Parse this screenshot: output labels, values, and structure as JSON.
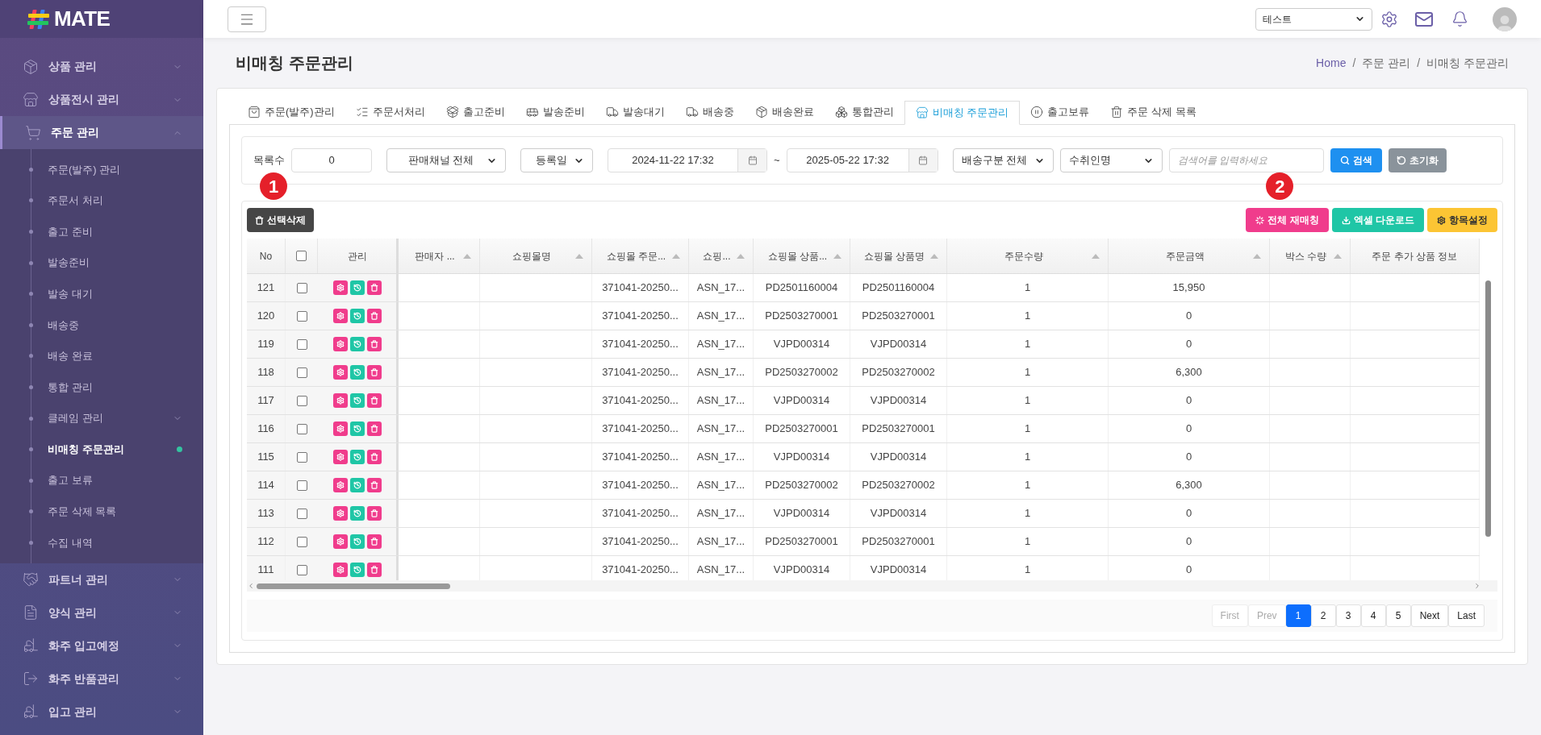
{
  "sidebar": {
    "logo": "MATE",
    "groups": [
      {
        "label": "상품 관리",
        "expanded": false,
        "has_submenu": true
      },
      {
        "label": "상품전시 관리",
        "expanded": false,
        "has_submenu": true
      },
      {
        "label": "주문 관리",
        "expanded": true,
        "has_submenu": true,
        "children": [
          {
            "label": "주문(발주) 관리",
            "selected": false,
            "has_submenu": false
          },
          {
            "label": "주문서 처리",
            "selected": false,
            "has_submenu": false
          },
          {
            "label": "출고 준비",
            "selected": false,
            "has_submenu": false
          },
          {
            "label": "발송준비",
            "selected": false,
            "has_submenu": false
          },
          {
            "label": "발송 대기",
            "selected": false,
            "has_submenu": false
          },
          {
            "label": "배송중",
            "selected": false,
            "has_submenu": false
          },
          {
            "label": "배송 완료",
            "selected": false,
            "has_submenu": false
          },
          {
            "label": "통합 관리",
            "selected": false,
            "has_submenu": false
          },
          {
            "label": "클레임 관리",
            "selected": false,
            "has_submenu": true
          },
          {
            "label": "비매칭 주문관리",
            "selected": true,
            "has_submenu": false
          },
          {
            "label": "출고 보류",
            "selected": false,
            "has_submenu": false
          },
          {
            "label": "주문 삭제 목록",
            "selected": false,
            "has_submenu": false
          },
          {
            "label": "수집 내역",
            "selected": false,
            "has_submenu": false
          }
        ]
      },
      {
        "label": "파트너 관리",
        "expanded": false,
        "has_submenu": true
      },
      {
        "label": "양식 관리",
        "expanded": false,
        "has_submenu": true
      },
      {
        "label": "화주 입고예정",
        "expanded": false,
        "has_submenu": true
      },
      {
        "label": "화주 반품관리",
        "expanded": false,
        "has_submenu": true
      },
      {
        "label": "입고 관리",
        "expanded": false,
        "has_submenu": true
      }
    ]
  },
  "header": {
    "account_select": "테스트"
  },
  "page": {
    "title": "비매칭 주문관리",
    "breadcrumb": [
      {
        "label": "Home",
        "kind": "link"
      },
      {
        "label": "/",
        "kind": "separator"
      },
      {
        "label": "주문 관리",
        "kind": "item"
      },
      {
        "label": "/",
        "kind": "separator"
      },
      {
        "label": "비매칭 주문관리",
        "kind": "item"
      }
    ]
  },
  "tabs": [
    {
      "label": "주문(발주)관리",
      "selected": false
    },
    {
      "label": "주문서처리",
      "selected": false
    },
    {
      "label": "출고준비",
      "selected": false
    },
    {
      "label": "발송준비",
      "selected": false
    },
    {
      "label": "발송대기",
      "selected": false
    },
    {
      "label": "배송중",
      "selected": false
    },
    {
      "label": "배송완료",
      "selected": false
    },
    {
      "label": "통합관리",
      "selected": false
    },
    {
      "label": "비매칭 주문관리",
      "selected": true
    },
    {
      "label": "출고보류",
      "selected": false
    },
    {
      "label": "주문 삭제 목록",
      "selected": false
    }
  ],
  "filters": {
    "count_label": "목록수",
    "count_value": "0",
    "channel": "판매채널 전체",
    "date_type": "등록일",
    "date_from": "2024-11-22 17:32",
    "range_sep": "~",
    "date_to": "2025-05-22 17:32",
    "delivery_type": "배송구분 전체",
    "search_field": "수취인명",
    "search": {
      "placeholder": "검색어를 입력하세요"
    },
    "search_button": "검색",
    "reset_button": "초기화"
  },
  "toolbar": {
    "delete_button": "선택삭제",
    "rematch_button": "전체 재매칭",
    "excel_button": "엑셀 다운로드",
    "columns_button": "항목설정"
  },
  "annotations": [
    {
      "label": "1"
    },
    {
      "label": "2"
    }
  ],
  "table": {
    "select_all_checked": false,
    "columns": [
      {
        "label": "No",
        "sortable": false
      },
      {
        "label": "관리",
        "sortable": false
      },
      {
        "label": "판매자 ...",
        "sortable": true
      },
      {
        "label": "쇼핑몰명",
        "sortable": true
      },
      {
        "label": "쇼핑몰 주문...",
        "sortable": true
      },
      {
        "label": "쇼핑...",
        "sortable": true
      },
      {
        "label": "쇼핑몰 상품...",
        "sortable": true
      },
      {
        "label": "쇼핑몰 상품명",
        "sortable": true
      },
      {
        "label": "주문수량",
        "sortable": true
      },
      {
        "label": "주문금액",
        "sortable": true
      },
      {
        "label": "박스 수량",
        "sortable": true
      },
      {
        "label": "주문 추가 상품 정보",
        "sortable": false
      }
    ],
    "rows": [
      {
        "no": "121",
        "checked": false,
        "order_no": "371041-20250...",
        "column_6": "ASN_17...",
        "product_code": "PD2501160004",
        "product_name": "PD2501160004",
        "qty": "1",
        "amount": "15,950"
      },
      {
        "no": "120",
        "checked": false,
        "order_no": "371041-20250...",
        "column_6": "ASN_17...",
        "product_code": "PD2503270001",
        "product_name": "PD2503270001",
        "qty": "1",
        "amount": "0"
      },
      {
        "no": "119",
        "checked": false,
        "order_no": "371041-20250...",
        "column_6": "ASN_17...",
        "product_code": "VJPD00314",
        "product_name": "VJPD00314",
        "qty": "1",
        "amount": "0"
      },
      {
        "no": "118",
        "checked": false,
        "order_no": "371041-20250...",
        "column_6": "ASN_17...",
        "product_code": "PD2503270002",
        "product_name": "PD2503270002",
        "qty": "1",
        "amount": "6,300"
      },
      {
        "no": "117",
        "checked": false,
        "order_no": "371041-20250...",
        "column_6": "ASN_17...",
        "product_code": "VJPD00314",
        "product_name": "VJPD00314",
        "qty": "1",
        "amount": "0"
      },
      {
        "no": "116",
        "checked": false,
        "order_no": "371041-20250...",
        "column_6": "ASN_17...",
        "product_code": "PD2503270001",
        "product_name": "PD2503270001",
        "qty": "1",
        "amount": "0"
      },
      {
        "no": "115",
        "checked": false,
        "order_no": "371041-20250...",
        "column_6": "ASN_17...",
        "product_code": "VJPD00314",
        "product_name": "VJPD00314",
        "qty": "1",
        "amount": "0"
      },
      {
        "no": "114",
        "checked": false,
        "order_no": "371041-20250...",
        "column_6": "ASN_17...",
        "product_code": "PD2503270002",
        "product_name": "PD2503270002",
        "qty": "1",
        "amount": "6,300"
      },
      {
        "no": "113",
        "checked": false,
        "order_no": "371041-20250...",
        "column_6": "ASN_17...",
        "product_code": "VJPD00314",
        "product_name": "VJPD00314",
        "qty": "1",
        "amount": "0"
      },
      {
        "no": "112",
        "checked": false,
        "order_no": "371041-20250...",
        "column_6": "ASN_17...",
        "product_code": "PD2503270001",
        "product_name": "PD2503270001",
        "qty": "1",
        "amount": "0"
      },
      {
        "no": "111",
        "checked": false,
        "order_no": "371041-20250...",
        "column_6": "ASN_17...",
        "product_code": "VJPD00314",
        "product_name": "VJPD00314",
        "qty": "1",
        "amount": "0"
      }
    ]
  },
  "pagination": [
    {
      "label": "First",
      "selected": false,
      "disabled": true
    },
    {
      "label": "Prev",
      "selected": false,
      "disabled": true
    },
    {
      "label": "1",
      "selected": true,
      "disabled": false
    },
    {
      "label": "2",
      "selected": false,
      "disabled": false
    },
    {
      "label": "3",
      "selected": false,
      "disabled": false
    },
    {
      "label": "4",
      "selected": false,
      "disabled": false
    },
    {
      "label": "5",
      "selected": false,
      "disabled": false
    },
    {
      "label": "Next",
      "selected": false,
      "disabled": false
    },
    {
      "label": "Last",
      "selected": false,
      "disabled": false
    }
  ]
}
